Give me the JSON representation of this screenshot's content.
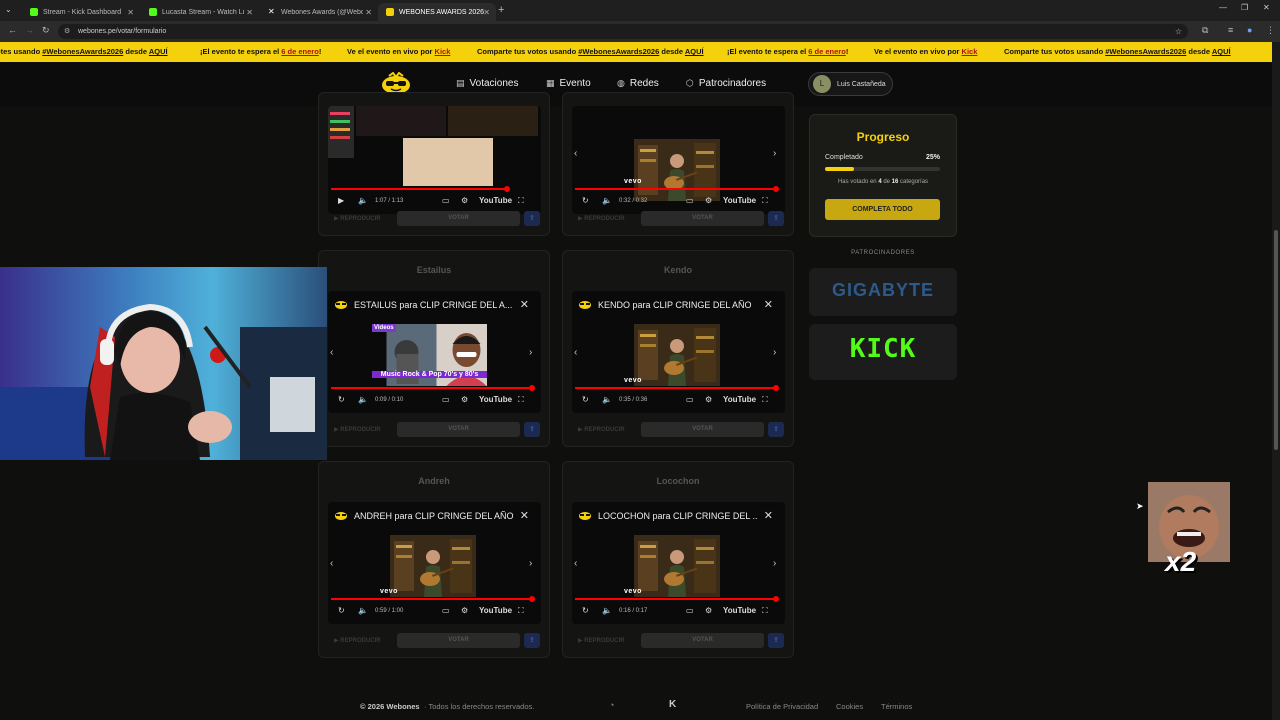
{
  "browser": {
    "tabs": [
      {
        "title": "Stream - Kick Dashboard",
        "color": "#53fc18"
      },
      {
        "title": "Lucasta Stream - Watch Live on",
        "color": "#53fc18"
      },
      {
        "title": "Webones Awards (@WebonesA",
        "color": "#ffffff"
      },
      {
        "title": "WEBONES AWARDS 2026",
        "color": "#f5d10c"
      }
    ],
    "url": "webones.pe/votar/formulario"
  },
  "ticker": {
    "items": [
      {
        "pre": "otes usando ",
        "tag": "#WebonesAwards2026",
        "mid": " desde ",
        "link": "AQUÍ",
        "post": ""
      },
      {
        "pre": "¡El evento te espera el ",
        "tag": "",
        "mid": "",
        "link": "6 de enero",
        "post": "!"
      },
      {
        "pre": "Ve el evento en vivo por ",
        "tag": "",
        "mid": "",
        "link": "Kick",
        "post": ""
      },
      {
        "pre": "Comparte tus votos usando ",
        "tag": "#WebonesAwards2026",
        "mid": " desde ",
        "link": "AQUÍ",
        "post": ""
      },
      {
        "pre": "¡El evento te espera el ",
        "tag": "",
        "mid": "",
        "link": "6 de enero",
        "post": "!"
      },
      {
        "pre": "Ve el evento en vivo por ",
        "tag": "",
        "mid": "",
        "link": "Kick",
        "post": ""
      },
      {
        "pre": "Comparte tus votos usando ",
        "tag": "#WebonesAwards2026",
        "mid": " desde ",
        "link": "AQUÍ",
        "post": ""
      }
    ]
  },
  "nav": {
    "votaciones": "Votaciones",
    "evento": "Evento",
    "redes": "Redes",
    "patrocinadores": "Patrocinadores",
    "user_initial": "L",
    "user_name": "Luis Castañeda"
  },
  "player_common": {
    "youtube": "YouTube",
    "vevo": "vevo",
    "reproducir": "REPRODUCIR",
    "votar": "VOTAR"
  },
  "cards": [
    {
      "name": "",
      "title": "",
      "time": "1:07 / 1:13"
    },
    {
      "name": "",
      "title": "",
      "time": "0:32 / 0:32"
    },
    {
      "name": "Estailus",
      "title": "ESTAILUS para CLIP CRINGE DEL A...",
      "time": "0:09 / 0:10"
    },
    {
      "name": "Kendo",
      "title": "KENDO para CLIP CRINGE DEL AÑO",
      "time": "0:35 / 0:36"
    },
    {
      "name": "Andreh",
      "title": "ANDREH para CLIP CRINGE DEL AÑO",
      "time": "0:59 / 1:00"
    },
    {
      "name": "Locochon",
      "title": "LOCOCHON para CLIP CRINGE DEL ...",
      "time": "0:16 / 0:17"
    }
  ],
  "thumb_overlay": {
    "videos": "Videos",
    "caption": "Music Rock & Pop 70's y 80's"
  },
  "progress": {
    "title": "Progreso",
    "completed_label": "Completado",
    "percent_text": "25%",
    "fraction": 0.25,
    "voted_pre": "Has votado en ",
    "voted_count": "4",
    "voted_mid": " de ",
    "voted_total": "16",
    "voted_post": " categorías",
    "complete_button": "COMPLETA TODO"
  },
  "sponsors": {
    "label": "PATROCINADORES",
    "gigabyte": "GIGABYTE",
    "kick": "KICK"
  },
  "footer": {
    "copyright": "© 2026 Webones",
    "rights": "· Todos los derechos reservados.",
    "privacy": "Política de Privacidad",
    "cookies": "Cookies",
    "terms": "Términos"
  },
  "overlay": {
    "emote_multiplier": "x2"
  },
  "colors": {
    "accent": "#f5d10c",
    "kick_green": "#53fc18",
    "youtube_red": "#ff0000"
  }
}
